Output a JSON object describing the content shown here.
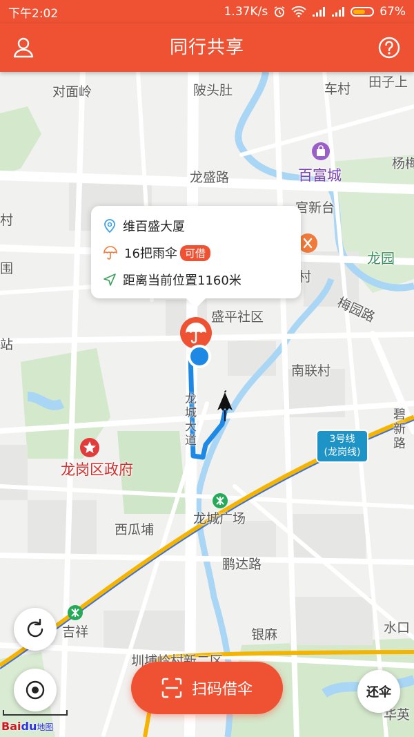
{
  "status_bar": {
    "time": "下午2:02",
    "network_speed": "1.37K/s",
    "battery_percent": "67%",
    "battery_level": 0.67,
    "icons": [
      "alarm-icon",
      "wifi-icon",
      "signal-icon",
      "signal-icon",
      "battery-icon"
    ]
  },
  "header": {
    "title": "同行共享",
    "left_icon": "user-icon",
    "right_icon": "help-icon",
    "background": "#ee5233"
  },
  "map": {
    "labels": [
      {
        "id": "duimianling",
        "text": "对面岭"
      },
      {
        "id": "bantoudu",
        "text": "陂头肚"
      },
      {
        "id": "checun",
        "text": "车村"
      },
      {
        "id": "tianzishang",
        "text": "田子上"
      },
      {
        "id": "yangmei",
        "text": "杨梅"
      },
      {
        "id": "baifucheng",
        "text": "百富城"
      },
      {
        "id": "longshenglu",
        "text": "龙盛路"
      },
      {
        "id": "guanxintai",
        "text": "官新台"
      },
      {
        "id": "cun_left",
        "text": "村"
      },
      {
        "id": "longyuan",
        "text": "龙园"
      },
      {
        "id": "wei",
        "text": "围"
      },
      {
        "id": "cun_mid",
        "text": "村"
      },
      {
        "id": "meiyuanlu",
        "text": "梅园路"
      },
      {
        "id": "shengpingshequ",
        "text": "盛平社区"
      },
      {
        "id": "zhan",
        "text": "站"
      },
      {
        "id": "nanliancun",
        "text": "南联村"
      },
      {
        "id": "longchengdadao",
        "text": "龙城大道"
      },
      {
        "id": "bixinlu",
        "text": "碧新路"
      },
      {
        "id": "longgangquzhengfu",
        "text": "龙岗区政府"
      },
      {
        "id": "xiguapu",
        "text": "西瓜埔"
      },
      {
        "id": "longchengguangchang",
        "text": "龙城广场"
      },
      {
        "id": "pengdalu",
        "text": "鹏达路"
      },
      {
        "id": "jixiang",
        "text": "吉祥"
      },
      {
        "id": "yinma",
        "text": "银麻"
      },
      {
        "id": "shuikou",
        "text": "水口"
      },
      {
        "id": "chuanbuling",
        "text": "圳埔岭村新二区"
      },
      {
        "id": "huaying",
        "text": "华英"
      }
    ],
    "metro_line_badge": {
      "line1": "3号线",
      "line2": "(龙岗线)"
    },
    "metro_line_color": "#f4b400",
    "route_color": "#1e88e5",
    "river_color": "#a9d6f5",
    "park_color": "#cfe6c8"
  },
  "popup": {
    "place_name": "维百盛大厦",
    "umbrella_count": "16把雨伞",
    "availability_badge": "可借",
    "distance": "距离当前位置1160米",
    "icons": [
      "location-pin-icon",
      "umbrella-icon",
      "navigation-arrow-icon"
    ]
  },
  "controls": {
    "refresh_icon": "refresh-icon",
    "locate_icon": "locate-icon",
    "scan_button_label": "扫码借伞",
    "scan_icon": "scan-icon",
    "return_button_label": "还伞"
  },
  "attribution": {
    "brand_a": "Bai",
    "brand_b": "du",
    "brand_c": "地图"
  }
}
